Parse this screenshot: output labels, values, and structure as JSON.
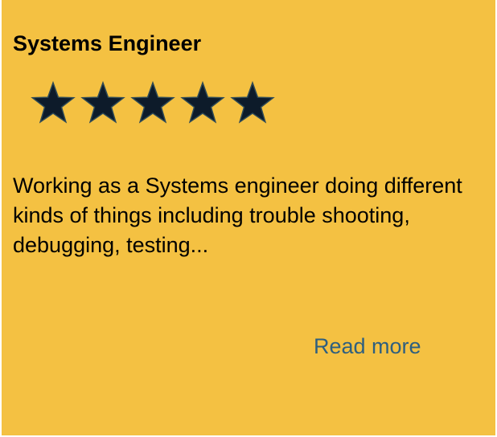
{
  "card": {
    "title": "Systems Engineer",
    "rating": {
      "value": 5,
      "max": 5
    },
    "description": "Working as a Systems engineer doing different kinds of things including trouble shooting, debugging, testing...",
    "read_more_label": "Read more",
    "colors": {
      "background": "#f4c142",
      "star_fill": "#0d1b2a",
      "star_stroke": "#2e4a56",
      "link": "#2e5f7f"
    },
    "icon": "star-icon"
  }
}
